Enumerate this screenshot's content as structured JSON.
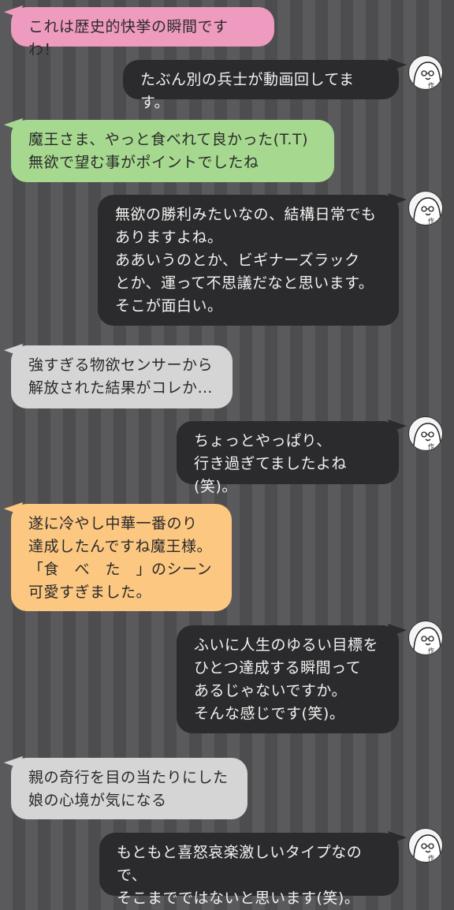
{
  "messages": [
    {
      "side": "left",
      "color": "pink",
      "text": "これは歴史的快挙の瞬間ですわ！"
    },
    {
      "side": "right",
      "color": "dark",
      "text": "たぶん別の兵士が動画回してます。",
      "avatar": "author-avatar-icon"
    },
    {
      "side": "left",
      "color": "green",
      "text": "魔王さま、やっと食べれて良かった(T.T)\n無欲で望む事がポイントでしたね"
    },
    {
      "side": "right",
      "color": "dark",
      "text": "無欲の勝利みたいなの、結構日常でも\nありますよね。\nああいうのとか、ビギナーズラック\nとか、運って不思議だなと思います。\nそこが面白い。",
      "avatar": "author-avatar-icon"
    },
    {
      "side": "left",
      "color": "gray",
      "text": "強すぎる物欲センサーから\n解放された結果がコレか…"
    },
    {
      "side": "right",
      "color": "dark",
      "text": "ちょっとやっぱり、\n行き過ぎてましたよね(笑)。",
      "avatar": "author-avatar-icon"
    },
    {
      "side": "left",
      "color": "orange",
      "text": "遂に冷やし中華一番のり\n達成したんですね魔王様。\n「食　べ　た　」のシーン\n可愛すぎました。"
    },
    {
      "side": "right",
      "color": "dark",
      "text": "ふいに人生のゆるい目標を\nひとつ達成する瞬間って\nあるじゃないですか。\nそんな感じです(笑)。",
      "avatar": "author-avatar-icon"
    },
    {
      "side": "left",
      "color": "gray",
      "text": "親の奇行を目の当たりにした\n娘の心境が気になる"
    },
    {
      "side": "right",
      "color": "dark",
      "text": "もともと喜怒哀楽激しいタイプなので、\nそこまでではないと思います(笑)。",
      "avatar": "author-avatar-icon"
    }
  ],
  "avatar_label": "作",
  "colors": {
    "dark": "#2b2b2d",
    "pink": "#ef9bc0",
    "green": "#a6d98f",
    "gray": "#d5d5d5",
    "orange": "#fcc781"
  }
}
